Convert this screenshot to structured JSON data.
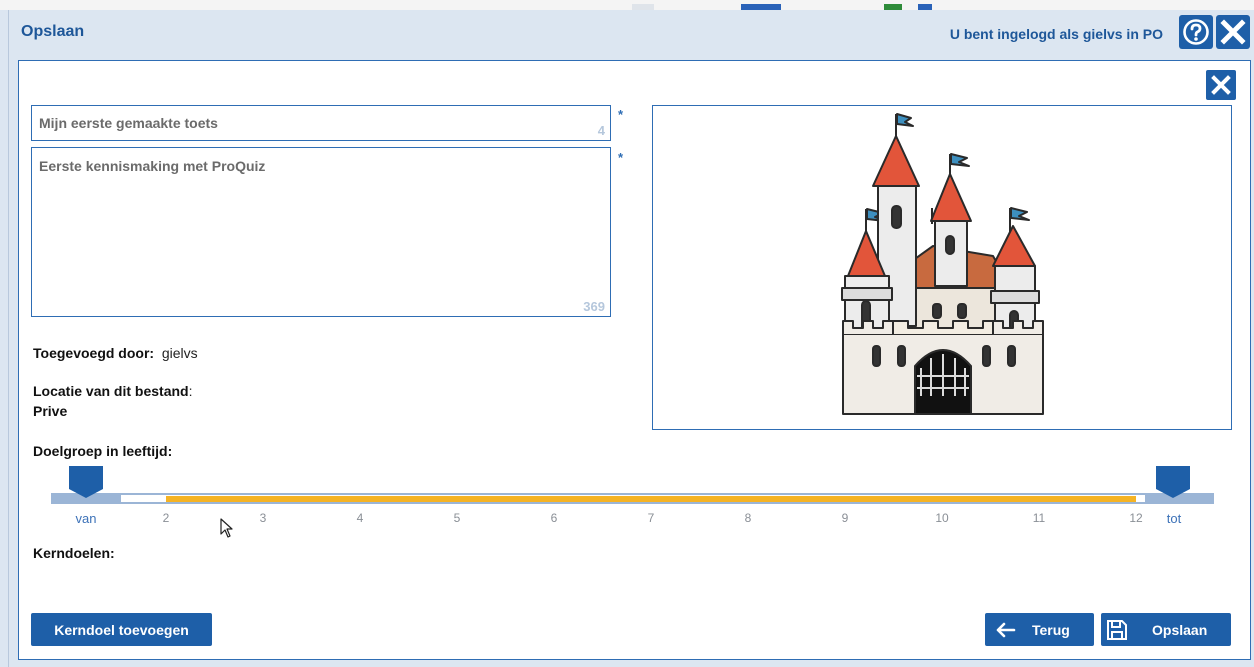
{
  "dialog": {
    "title": "Opslaan",
    "user_status": "U bent ingelogd als gielvs in PO"
  },
  "form": {
    "title_value": "Mijn eerste gemaakte toets",
    "title_count": "4",
    "description_value": "Eerste kennismaking met ProQuiz",
    "description_count": "369",
    "required_mark": "*",
    "added_by_label": "Toegevoegd door:",
    "added_by_value": "gielvs",
    "location_label": "Locatie van dit bestand",
    "location_colon": ":",
    "location_value": "Prive",
    "age_label": "Doelgroep in leeftijd:",
    "core_goals_label": "Kerndoelen:"
  },
  "slider": {
    "from_label": "van",
    "to_label": "tot",
    "ticks": [
      "2",
      "3",
      "4",
      "5",
      "6",
      "7",
      "8",
      "9",
      "10",
      "11",
      "12"
    ],
    "selected_min": 2,
    "selected_max": 12,
    "track_color": "#9bb5d6",
    "fill_color": "#f5b324",
    "handle_color": "#1e5fa8"
  },
  "buttons": {
    "add_core_goal": "Kerndoel toevoegen",
    "back": "Terug",
    "save": "Opslaan"
  },
  "colors": {
    "primary": "#1e5fa8",
    "border": "#2e6db4",
    "background": "#dce6f1"
  },
  "icons": {
    "help": "help-circle-icon",
    "close": "close-icon",
    "back": "arrow-left-icon",
    "save": "floppy-disk-icon"
  }
}
